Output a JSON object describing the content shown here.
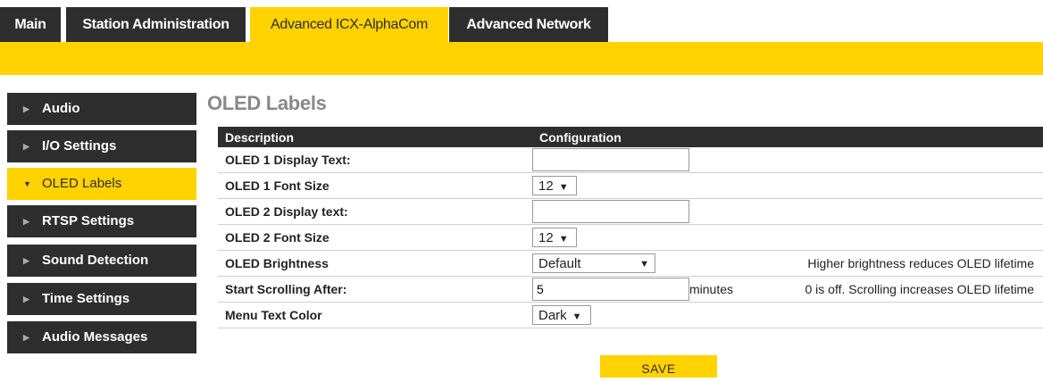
{
  "tabs": [
    {
      "label": "Main"
    },
    {
      "label": "Station Administration"
    },
    {
      "label": "Advanced ICX-AlphaCom"
    },
    {
      "label": "Advanced Network"
    }
  ],
  "sidebar": {
    "items": [
      {
        "label": "Audio",
        "arrow": "▶"
      },
      {
        "label": "I/O Settings",
        "arrow": "▶"
      },
      {
        "label": "OLED Labels",
        "arrow": "▼"
      },
      {
        "label": "RTSP Settings",
        "arrow": "▶"
      },
      {
        "label": "Sound Detection",
        "arrow": "▶"
      },
      {
        "label": "Time Settings",
        "arrow": "▶"
      },
      {
        "label": "Audio Messages",
        "arrow": "▶"
      }
    ]
  },
  "main": {
    "title": "OLED Labels",
    "headers": {
      "description": "Description",
      "configuration": "Configuration"
    },
    "rows": {
      "oled1_text": {
        "label": "OLED 1 Display Text:",
        "value": ""
      },
      "oled1_font": {
        "label": "OLED 1 Font Size",
        "value": "12"
      },
      "oled2_text": {
        "label": "OLED 2 Display text:",
        "value": ""
      },
      "oled2_font": {
        "label": "OLED 2 Font Size",
        "value": "12"
      },
      "brightness": {
        "label": "OLED Brightness",
        "value": "Default",
        "note": "Higher brightness reduces OLED lifetime"
      },
      "scrolling": {
        "label": "Start Scrolling After:",
        "value": "5",
        "unit": "minutes",
        "note": "0 is off. Scrolling increases OLED lifetime"
      },
      "menu_color": {
        "label": "Menu Text Color",
        "value": "Dark"
      }
    },
    "save_label": "SAVE",
    "caret": "▼"
  },
  "colors": {
    "accent": "#ffd200",
    "dark": "#2e2e2e"
  }
}
